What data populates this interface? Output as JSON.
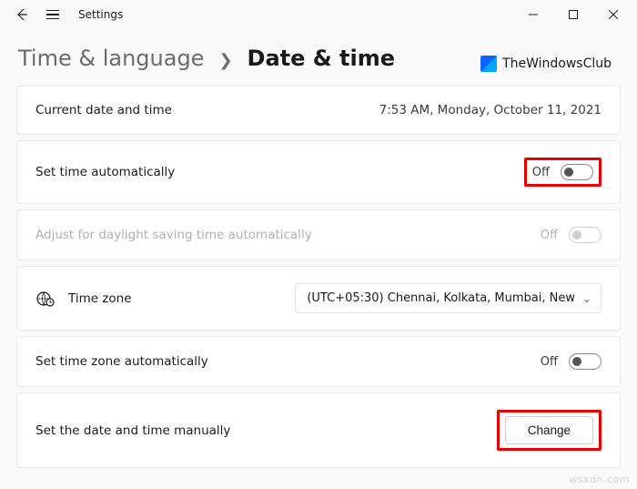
{
  "app": {
    "title": "Settings"
  },
  "breadcrumb": {
    "parent": "Time & language",
    "current": "Date & time"
  },
  "logo": {
    "text": "TheWindowsClub"
  },
  "rows": {
    "current": {
      "label": "Current date and time",
      "value": "7:53 AM, Monday, October 11, 2021"
    },
    "autoTime": {
      "label": "Set time automatically",
      "state": "Off"
    },
    "dst": {
      "label": "Adjust for daylight saving time automatically",
      "state": "Off"
    },
    "timezone": {
      "label": "Time zone",
      "selected": "(UTC+05:30) Chennai, Kolkata, Mumbai, New"
    },
    "autoTz": {
      "label": "Set time zone automatically",
      "state": "Off"
    },
    "manual": {
      "label": "Set the date and time manually",
      "button": "Change"
    }
  },
  "watermark": "wsxdn.com"
}
